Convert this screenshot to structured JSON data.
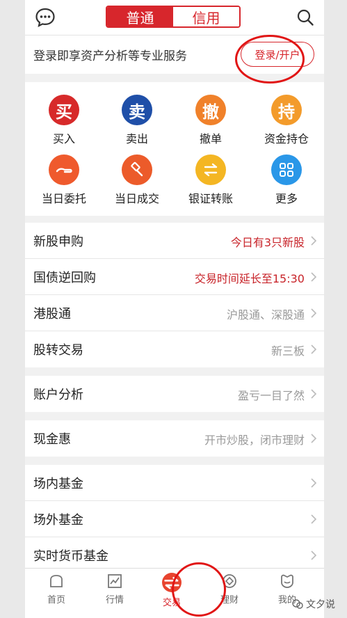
{
  "header": {
    "tabs": [
      "普通",
      "信用"
    ]
  },
  "login": {
    "text": "登录即享资产分析等专业服务",
    "button": "登录/开户"
  },
  "grid": [
    {
      "glyph": "买",
      "label": "买入",
      "color": "#d72a2a"
    },
    {
      "glyph": "卖",
      "label": "卖出",
      "color": "#1f4fa8"
    },
    {
      "glyph": "撤",
      "label": "撤单",
      "color": "#f0812a"
    },
    {
      "glyph": "持",
      "label": "资金持仓",
      "color": "#f39b2b"
    },
    {
      "glyph": "",
      "label": "当日委托",
      "color": "#ef5a2d",
      "icon": "hand-icon"
    },
    {
      "glyph": "",
      "label": "当日成交",
      "color": "#ec5b2a",
      "icon": "gavel-icon"
    },
    {
      "glyph": "",
      "label": "银证转账",
      "color": "#f4b623",
      "icon": "transfer-icon"
    },
    {
      "glyph": "",
      "label": "更多",
      "color": "#2a97e8",
      "icon": "grid-icon"
    }
  ],
  "group1": [
    {
      "label": "新股申购",
      "value": "今日有3只新股",
      "highlight": true
    },
    {
      "label": "国债逆回购",
      "value": "交易时间延长至15:30",
      "highlight": true
    },
    {
      "label": "港股通",
      "value": "沪股通、深股通",
      "highlight": false
    },
    {
      "label": "股转交易",
      "value": "新三板",
      "highlight": false
    }
  ],
  "group2": [
    {
      "label": "账户分析",
      "value": "盈亏一目了然"
    }
  ],
  "group3": [
    {
      "label": "现金惠",
      "value": "开市炒股，闭市理财"
    }
  ],
  "group4": [
    {
      "label": "场内基金",
      "value": ""
    },
    {
      "label": "场外基金",
      "value": ""
    },
    {
      "label": "实时货币基金",
      "value": ""
    }
  ],
  "tabbar": [
    {
      "label": "首页",
      "icon": "home-icon"
    },
    {
      "label": "行情",
      "icon": "chart-icon"
    },
    {
      "label": "交易",
      "icon": "trade-icon",
      "active": true
    },
    {
      "label": "理财",
      "icon": "finance-icon"
    },
    {
      "label": "我的",
      "icon": "profile-icon"
    }
  ],
  "watermark": "文夕说",
  "colors": {
    "brand_red": "#d7262c",
    "annotation_red": "#e11515"
  }
}
